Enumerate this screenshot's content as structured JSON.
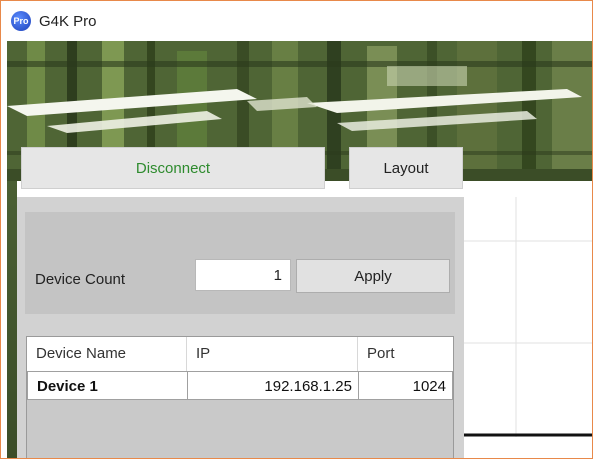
{
  "window": {
    "title": "G4K Pro",
    "icon": "app-logo-icon",
    "icon_text": "Pro"
  },
  "toolbar": {
    "disconnect_label": "Disconnect",
    "layout_label": "Layout"
  },
  "device_panel": {
    "count_label": "Device Count",
    "count_value": "1",
    "apply_label": "Apply"
  },
  "device_table": {
    "columns": [
      "Device Name",
      "IP",
      "Port"
    ],
    "rows": [
      {
        "name": "Device 1",
        "ip": "192.168.1.25",
        "port": "1024"
      }
    ]
  },
  "colors": {
    "disconnect_text": "#2e8b2e",
    "window_border": "#e8894a",
    "panel_bg": "#d2d2d2"
  }
}
